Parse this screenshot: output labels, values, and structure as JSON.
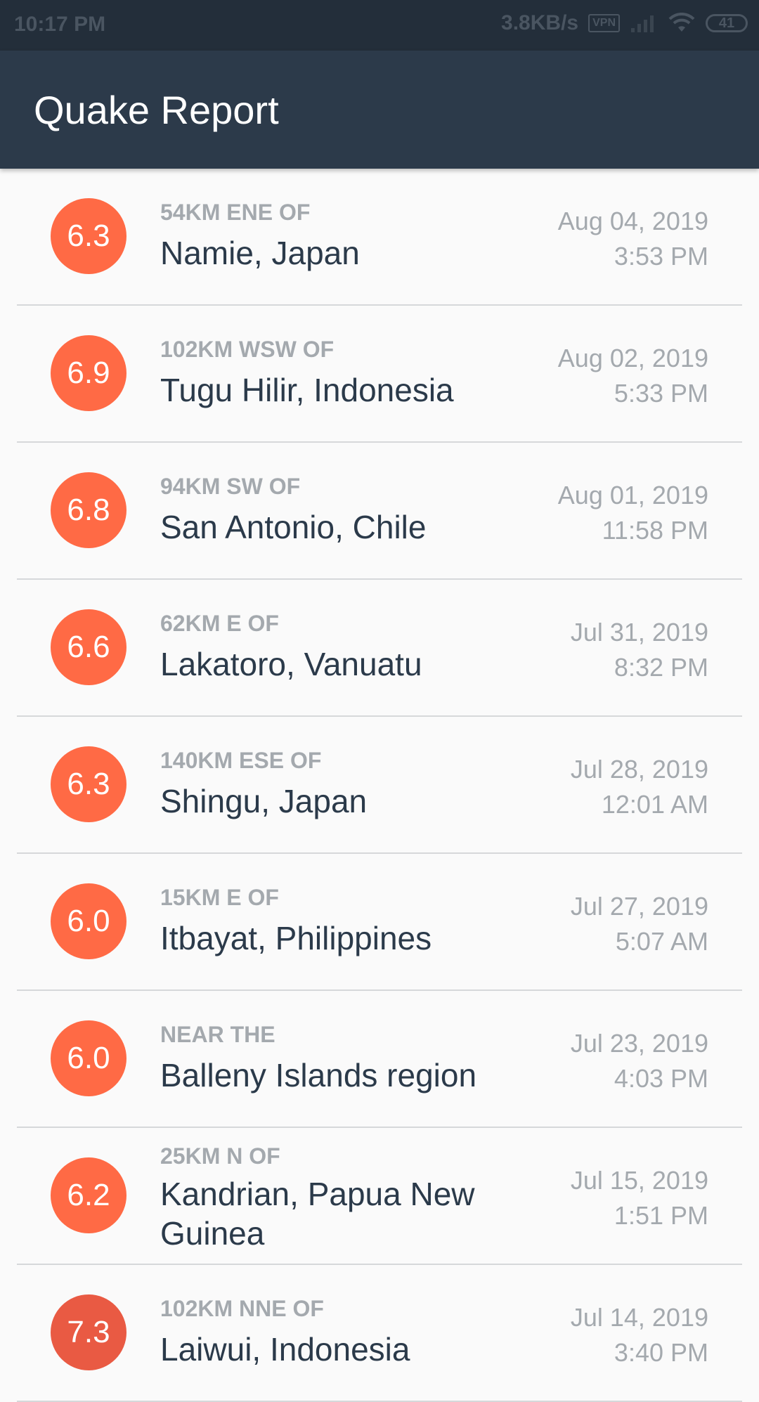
{
  "status_bar": {
    "time": "10:17 PM",
    "speed": "3.8KB/s",
    "vpn": "VPN",
    "battery": "41"
  },
  "app_bar": {
    "title": "Quake Report"
  },
  "colors": {
    "app_bar": "#2c3a4a",
    "status_bar": "#232e3a",
    "magnitude_6": "#ff6a45",
    "magnitude_7": "#e95a43"
  },
  "earthquakes": [
    {
      "magnitude": "6.3",
      "offset": "54KM ENE OF",
      "location": "Namie, Japan",
      "date": "Aug 04, 2019",
      "time": "3:53 PM",
      "color": "#ff6a45"
    },
    {
      "magnitude": "6.9",
      "offset": "102KM WSW OF",
      "location": "Tugu Hilir, Indonesia",
      "date": "Aug 02, 2019",
      "time": "5:33 PM",
      "color": "#ff6a45"
    },
    {
      "magnitude": "6.8",
      "offset": "94KM SW OF",
      "location": "San Antonio, Chile",
      "date": "Aug 01, 2019",
      "time": "11:58 PM",
      "color": "#ff6a45"
    },
    {
      "magnitude": "6.6",
      "offset": "62KM E OF",
      "location": "Lakatoro, Vanuatu",
      "date": "Jul 31, 2019",
      "time": "8:32 PM",
      "color": "#ff6a45"
    },
    {
      "magnitude": "6.3",
      "offset": "140KM ESE OF",
      "location": "Shingu, Japan",
      "date": "Jul 28, 2019",
      "time": "12:01 AM",
      "color": "#ff6a45"
    },
    {
      "magnitude": "6.0",
      "offset": "15KM E OF",
      "location": "Itbayat, Philippines",
      "date": "Jul 27, 2019",
      "time": "5:07 AM",
      "color": "#ff6a45"
    },
    {
      "magnitude": "6.0",
      "offset": "NEAR THE",
      "location": "Balleny Islands region",
      "date": "Jul 23, 2019",
      "time": "4:03 PM",
      "color": "#ff6a45"
    },
    {
      "magnitude": "6.2",
      "offset": "25KM N OF",
      "location": "Kandrian, Papua New Guinea",
      "date": "Jul 15, 2019",
      "time": "1:51 PM",
      "color": "#ff6a45"
    },
    {
      "magnitude": "7.3",
      "offset": "102KM NNE OF",
      "location": "Laiwui, Indonesia",
      "date": "Jul 14, 2019",
      "time": "3:40 PM",
      "color": "#e95a43"
    }
  ]
}
